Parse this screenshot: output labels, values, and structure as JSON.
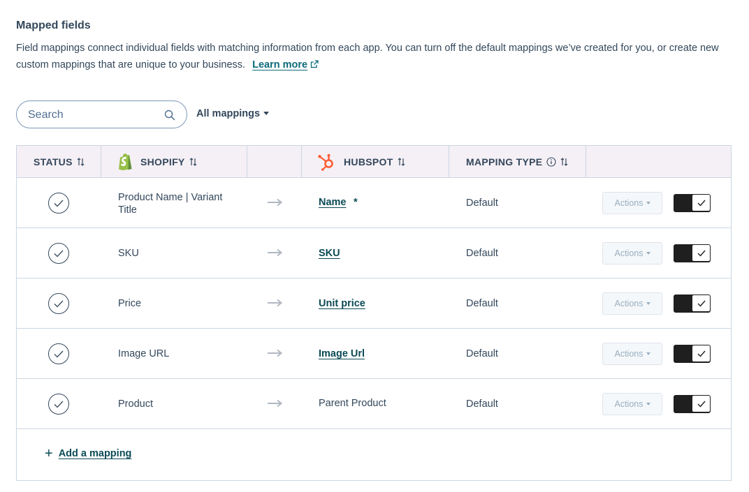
{
  "section": {
    "title": "Mapped fields",
    "description": "Field mappings connect individual fields with matching information from each app. You can turn off the default mappings we’ve created for you, or create new custom mappings that are unique to your business.",
    "learn_more": "Learn more"
  },
  "search": {
    "placeholder": "Search",
    "value": ""
  },
  "filter": {
    "label": "All mappings"
  },
  "table": {
    "headers": {
      "status": "STATUS",
      "shopify": "SHOPIFY",
      "hubspot": "HUBSPOT",
      "mapping_type": "MAPPING TYPE"
    },
    "rows": [
      {
        "source": "Product Name | Variant Title",
        "target": "Name",
        "required_mark": "*",
        "target_linked": true,
        "type": "Default",
        "action_label": "Actions",
        "enabled": true
      },
      {
        "source": "SKU",
        "target": "SKU",
        "required_mark": "",
        "target_linked": true,
        "type": "Default",
        "action_label": "Actions",
        "enabled": true
      },
      {
        "source": "Price",
        "target": "Unit price",
        "required_mark": "",
        "target_linked": true,
        "type": "Default",
        "action_label": "Actions",
        "enabled": true
      },
      {
        "source": "Image URL",
        "target": "Image Url",
        "required_mark": "",
        "target_linked": true,
        "type": "Default",
        "action_label": "Actions",
        "enabled": true
      },
      {
        "source": "Product",
        "target": "Parent Product",
        "required_mark": "",
        "target_linked": false,
        "type": "Default",
        "action_label": "Actions",
        "enabled": true
      }
    ],
    "add_mapping": "Add a mapping"
  },
  "colors": {
    "text": "#33475b",
    "link": "#0b4a55",
    "header_bg": "#f5f0f6",
    "border": "#cbd6e2",
    "hubspot_orange": "#ff5c35",
    "shopify_green": "#95bf47",
    "toggle_on": "#1f1f1f"
  },
  "icons": {
    "search": "search-icon",
    "external": "external-link-icon",
    "sort": "sort-icon",
    "info": "info-icon",
    "status": "check-circle-icon",
    "arrow": "arrow-right-icon",
    "shopify": "shopify-logo",
    "hubspot": "hubspot-logo"
  }
}
